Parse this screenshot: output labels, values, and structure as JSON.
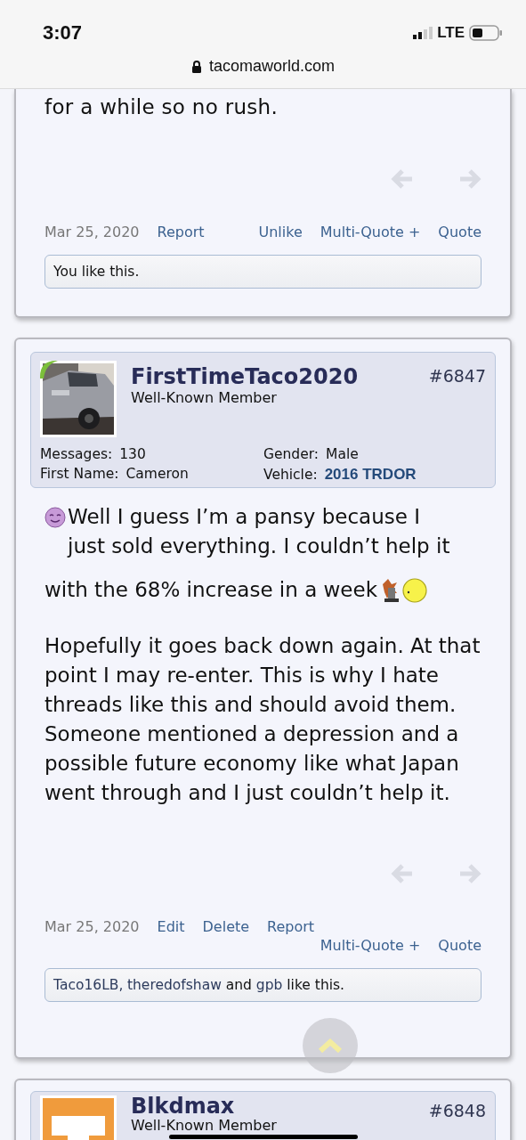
{
  "status_bar": {
    "time": "3:07",
    "network": "LTE"
  },
  "address_bar": {
    "url": "tacomaworld.com"
  },
  "posts": [
    {
      "kind": "partial_top",
      "message": [
        "for a while so no rush."
      ],
      "date": "Mar 25, 2020",
      "actions_left": [
        "Report"
      ],
      "actions_right": [
        "Unlike",
        "Multi-Quote +",
        "Quote"
      ],
      "likes": [
        {
          "kind": "plain",
          "text": "You like this."
        }
      ]
    },
    {
      "kind": "full",
      "author": {
        "name": "FirstTimeTaco2020",
        "title": "Well-Known Member",
        "online": true
      },
      "number": "#6847",
      "stats": [
        {
          "label": "Messages:",
          "value": "130",
          "kind": "plain"
        },
        {
          "label": "Gender:",
          "value": "Male",
          "kind": "plain"
        },
        {
          "label": "First Name:",
          "value": "Cameron",
          "kind": "plain"
        },
        {
          "label": "Vehicle:",
          "value": "2016 TRDOR",
          "kind": "strong"
        }
      ],
      "message": [
        "Well I guess I’m a pansy because I just sold everything. I couldn’t help it",
        "with the 68% increase in a week",
        "Hopefully it goes back down again. At that point I may re-enter. This is why I hate threads like this and should avoid them. Someone mentioned a depression and a possible future economy like what Japan went through and I just couldn’t help it."
      ],
      "date": "Mar 25, 2020",
      "actions_left": [
        "Edit",
        "Delete",
        "Report"
      ],
      "actions_right": [
        "Multi-Quote +",
        "Quote"
      ],
      "likes": [
        {
          "kind": "link",
          "text": "Taco16LB,"
        },
        {
          "kind": "link",
          "text": "theredofshaw"
        },
        {
          "kind": "plain",
          "text": " and "
        },
        {
          "kind": "link",
          "text": "gpb"
        },
        {
          "kind": "plain",
          "text": " like this."
        }
      ]
    },
    {
      "kind": "partial_bottom",
      "author": {
        "name": "Blkdmax",
        "title": "Well-Known Member",
        "online": false
      },
      "number": "#6848"
    }
  ]
}
